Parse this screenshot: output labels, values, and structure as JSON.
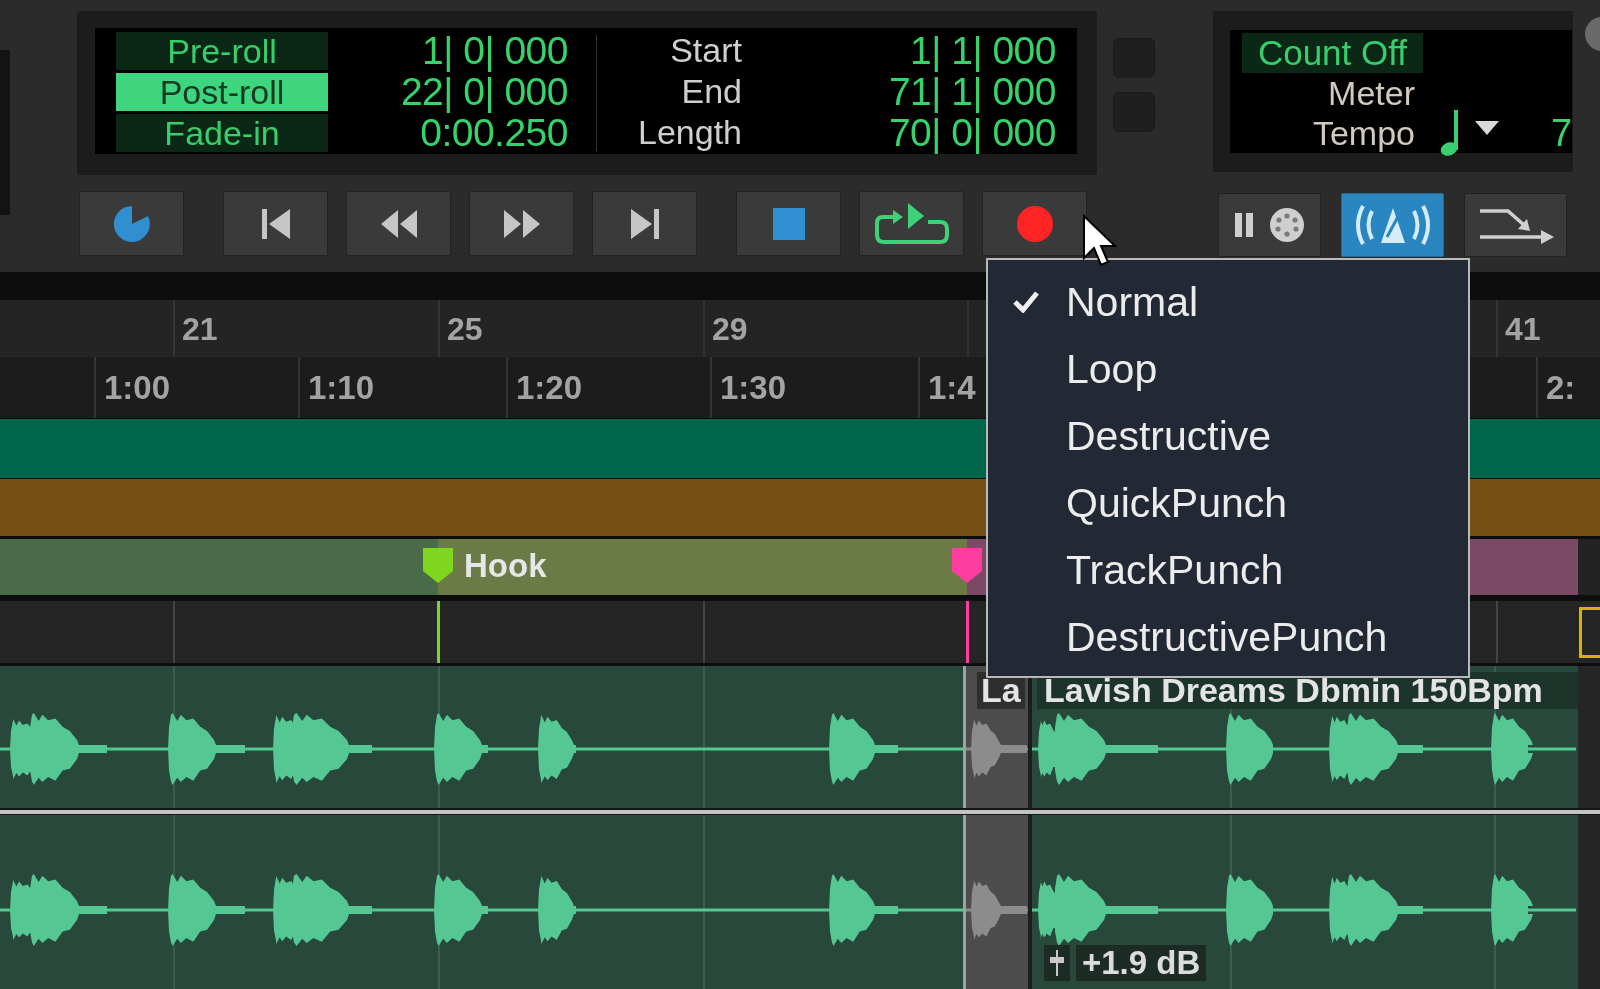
{
  "counter": {
    "roll_settings": [
      {
        "label": "Pre-roll",
        "value": "1| 0| 000",
        "on": false
      },
      {
        "label": "Post-roll",
        "value": "22| 0| 000",
        "on": true
      },
      {
        "label": "Fade-in",
        "value": "0:00.250",
        "on": false
      }
    ],
    "selection": [
      {
        "label": "Start",
        "value": "1| 1| 000"
      },
      {
        "label": "End",
        "value": "71| 1| 000"
      },
      {
        "label": "Length",
        "value": "70| 0| 000"
      }
    ]
  },
  "transport_buttons": [
    {
      "kind": "online"
    },
    {
      "kind": "go-to-start"
    },
    {
      "kind": "rewind"
    },
    {
      "kind": "fast-forward"
    },
    {
      "kind": "go-to-end"
    },
    {
      "kind": "stop"
    },
    {
      "kind": "loop-play"
    },
    {
      "kind": "record"
    }
  ],
  "midi_panel": {
    "count_off": {
      "label": "Count Off",
      "on": false
    },
    "meter_label": "Meter",
    "tempo_label": "Tempo",
    "tempo_value": "7"
  },
  "midi_buttons": [
    {
      "kind": "wait-for-note",
      "on": false
    },
    {
      "kind": "metronome",
      "on": true
    },
    {
      "kind": "merge",
      "on": false
    }
  ],
  "ruler": {
    "bars": [
      "21",
      "25",
      "29",
      "41"
    ],
    "timecodes": [
      "1:00",
      "1:10",
      "1:20",
      "1:30",
      "1:4",
      "2:"
    ]
  },
  "markers": [
    {
      "name": "Hook",
      "color": "#7fd61f"
    },
    {
      "color": "#ff3d9e"
    }
  ],
  "tracks": {
    "clips": [
      {
        "name": "La"
      },
      {
        "name": "Lavish Dreams Dbmin 150Bpm"
      }
    ],
    "clip_gain": "+1.9 dB"
  },
  "record_mode_menu": {
    "items": [
      {
        "label": "Normal",
        "checked": true
      },
      {
        "label": "Loop",
        "checked": false
      },
      {
        "label": "Destructive",
        "checked": false
      },
      {
        "label": "QuickPunch",
        "checked": false
      },
      {
        "label": "TrackPunch",
        "checked": false
      },
      {
        "label": "DestructivePunch",
        "checked": false
      }
    ]
  }
}
